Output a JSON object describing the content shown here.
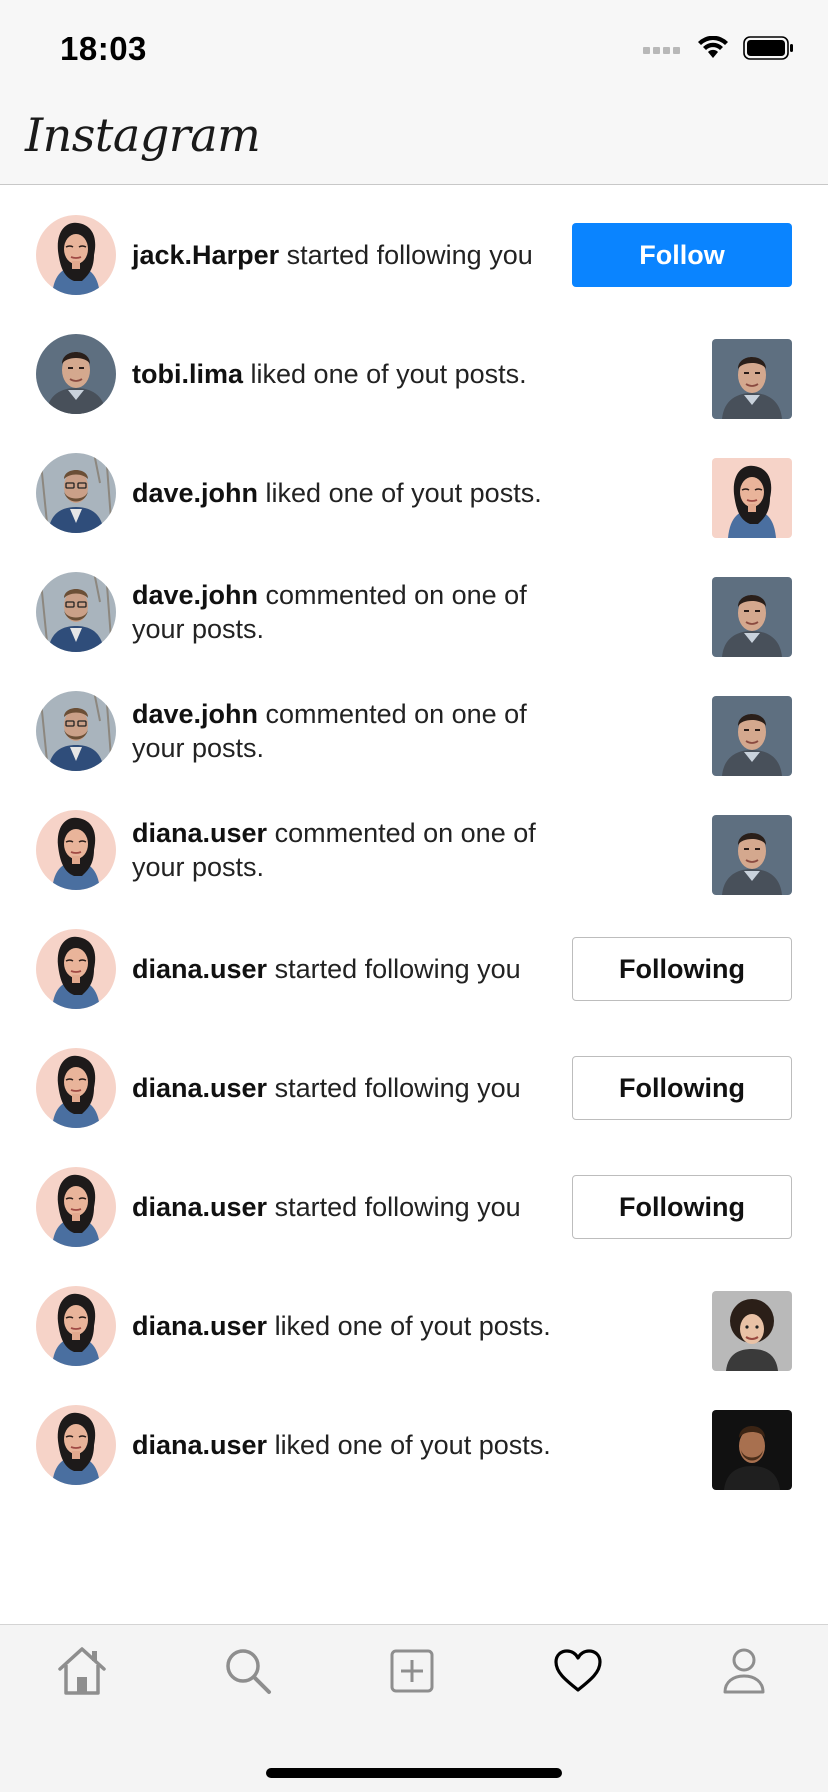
{
  "status_bar": {
    "time": "18:03"
  },
  "header": {
    "brand": "Instagram"
  },
  "notifications": [
    {
      "username": "jack.Harper",
      "text": " started following you",
      "avatar": "woman-portrait",
      "action": "button",
      "button_label": "Follow",
      "button_style": "follow"
    },
    {
      "username": "tobi.lima",
      "text": " liked one of yout posts.",
      "avatar": "man-portrait",
      "action": "thumb",
      "thumb": "man-portrait"
    },
    {
      "username": "dave.john",
      "text": " liked one of yout posts.",
      "avatar": "bearded-man-portrait",
      "action": "thumb",
      "thumb": "woman-portrait"
    },
    {
      "username": "dave.john",
      "text": " commented on one of your posts.",
      "avatar": "bearded-man-portrait",
      "action": "thumb",
      "thumb": "man-portrait"
    },
    {
      "username": "dave.john",
      "text": " commented on one of your posts.",
      "avatar": "bearded-man-portrait",
      "action": "thumb",
      "thumb": "man-portrait"
    },
    {
      "username": "diana.user",
      "text": " commented on one of your posts.",
      "avatar": "woman-portrait",
      "action": "thumb",
      "thumb": "man-portrait"
    },
    {
      "username": "diana.user",
      "text": " started following you",
      "avatar": "woman-portrait",
      "action": "button",
      "button_label": "Following",
      "button_style": "following"
    },
    {
      "username": "diana.user",
      "text": " started following you",
      "avatar": "woman-portrait",
      "action": "button",
      "button_label": "Following",
      "button_style": "following"
    },
    {
      "username": "diana.user",
      "text": " started following you",
      "avatar": "woman-portrait",
      "action": "button",
      "button_label": "Following",
      "button_style": "following"
    },
    {
      "username": "diana.user",
      "text": " liked one of yout posts.",
      "avatar": "woman-portrait",
      "action": "thumb",
      "thumb": "curly-hair-portrait"
    },
    {
      "username": "diana.user",
      "text": " liked one of yout posts.",
      "avatar": "woman-portrait",
      "action": "thumb",
      "thumb": "dark-man-portrait"
    }
  ],
  "tab_bar": {
    "items": [
      {
        "name": "home",
        "icon": "home-icon"
      },
      {
        "name": "search",
        "icon": "search-icon"
      },
      {
        "name": "add-post",
        "icon": "add-square-icon"
      },
      {
        "name": "activity",
        "icon": "heart-icon",
        "active": true
      },
      {
        "name": "profile",
        "icon": "profile-icon"
      }
    ]
  },
  "colors": {
    "accent": "#0a84ff",
    "background": "#ffffff",
    "bar_background": "#f7f7f7"
  }
}
